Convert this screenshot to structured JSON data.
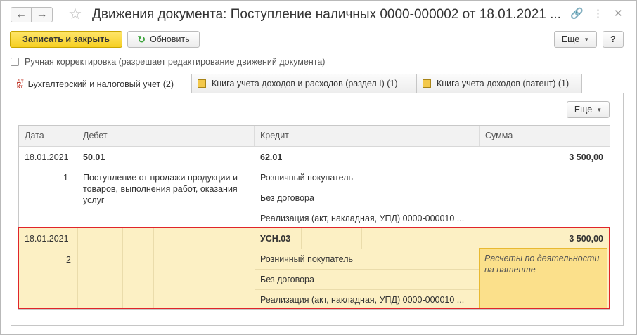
{
  "window": {
    "title": "Движения документа: Поступление наличных 0000-000002 от 18.01.2021 ..."
  },
  "toolbar": {
    "save_close": "Записать и закрыть",
    "refresh": "Обновить",
    "more": "Еще",
    "help": "?"
  },
  "manual_correction": {
    "label": "Ручная корректировка (разрешает редактирование движений документа)",
    "checked": false
  },
  "tabs": [
    {
      "label": "Бухгалтерский и налоговый учет (2)",
      "icon": "dt-kt-icon",
      "active": true
    },
    {
      "label": "Книга учета доходов и расходов (раздел I) (1)",
      "icon": "book-icon",
      "active": false
    },
    {
      "label": "Книга учета доходов (патент) (1)",
      "icon": "book-icon",
      "active": false
    }
  ],
  "panel": {
    "more": "Еще",
    "icon_dtkt_top": "Дт",
    "icon_dtkt_bottom": "Кт"
  },
  "table": {
    "columns": [
      "Дата",
      "Дебет",
      "Кредит",
      "Сумма"
    ],
    "rows": [
      {
        "date": "18.01.2021",
        "num": "1",
        "debit_account": "50.01",
        "debit_subconto": "Поступление от продажи продукции и товаров, выполнения работ, оказания услуг",
        "credit_account": "62.01",
        "credit_sub1": "Розничный покупатель",
        "credit_sub2": "Без договора",
        "credit_sub3": "Реализация (акт, накладная, УПД) 0000-000010 ...",
        "amount": "3 500,00"
      },
      {
        "date": "18.01.2021",
        "num": "2",
        "credit_account": "УСН.03",
        "credit_sub1": "Розничный покупатель",
        "credit_sub2": "Без договора",
        "credit_sub3": "Реализация (акт, накладная, УПД) 0000-000010 ...",
        "amount": "3 500,00",
        "note": "Расчеты по деятельности на патенте"
      }
    ]
  },
  "colors": {
    "highlight_border": "#e0252a",
    "row_highlight": "#fcf0c4",
    "primary_button": "#f6cf22"
  }
}
